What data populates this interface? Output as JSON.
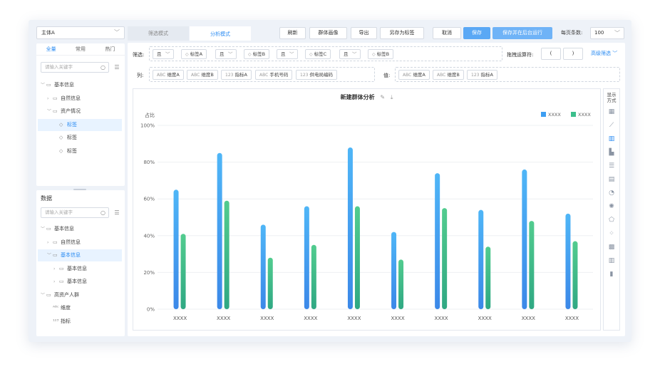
{
  "entity": {
    "value": "主体A"
  },
  "left_top": {
    "tabs": [
      "全量",
      "常用",
      "热门"
    ],
    "active_tab": 0,
    "search_placeholder": "请输入关键字",
    "tree": [
      {
        "label": "基本信息",
        "level": 0,
        "caret": "﹀",
        "icon": "folder-icon"
      },
      {
        "label": "自然信息",
        "level": 1,
        "caret": "›",
        "icon": "folder-icon"
      },
      {
        "label": "资产情况",
        "level": 1,
        "caret": "﹀",
        "icon": "folder-icon"
      },
      {
        "label": "标签",
        "level": 2,
        "caret": "",
        "icon": "tag-icon",
        "selected": true
      },
      {
        "label": "标签",
        "level": 2,
        "caret": "",
        "icon": "tag-icon"
      },
      {
        "label": "标签",
        "level": 2,
        "caret": "",
        "icon": "tag-icon"
      }
    ]
  },
  "left_bottom": {
    "title": "数据",
    "search_placeholder": "请输入关键字",
    "tree": [
      {
        "label": "基本信息",
        "level": 0,
        "caret": "﹀",
        "icon": "folder-icon"
      },
      {
        "label": "自然信息",
        "level": 1,
        "caret": "›",
        "icon": "folder-icon"
      },
      {
        "label": "基本信息",
        "level": 1,
        "caret": "﹀",
        "icon": "folder-icon",
        "selected": true
      },
      {
        "label": "基本信息",
        "level": 2,
        "caret": "›",
        "icon": "folder-icon"
      },
      {
        "label": "基本信息",
        "level": 2,
        "caret": "›",
        "icon": "folder-icon"
      },
      {
        "label": "高资产人群",
        "level": 0,
        "caret": "﹀",
        "icon": "folder-icon"
      },
      {
        "label": "维度",
        "level": 1,
        "caret": "",
        "icon": "abc-icon"
      },
      {
        "label": "指标",
        "level": 1,
        "caret": "",
        "icon": "number-icon"
      }
    ]
  },
  "mode_tabs": {
    "filter": "筛选模式",
    "analysis": "分析模式"
  },
  "toolbar": {
    "refresh": "刷新",
    "portrait": "群体画像",
    "export": "导出",
    "save_as_tag": "另存为标签",
    "cancel": "取消",
    "save": "保存",
    "save_run": "保存并在后台运行",
    "per_page_label": "每页条数:",
    "per_page_value": "100"
  },
  "filter_row": {
    "label": "筛选:",
    "items": [
      {
        "type": "select",
        "text": "且"
      },
      {
        "type": "tag",
        "text": "标签A"
      },
      {
        "type": "select",
        "text": "且"
      },
      {
        "type": "tag",
        "text": "标签B"
      },
      {
        "type": "select",
        "text": "且"
      },
      {
        "type": "tag",
        "text": "标签C"
      },
      {
        "type": "select",
        "text": "且"
      },
      {
        "type": "tag",
        "text": "标签B"
      }
    ],
    "drag_label": "拖拽运算符:",
    "paren_open": "(",
    "paren_close": ")",
    "advanced": "高级筛选 ﹀"
  },
  "column_row": {
    "label": "列:",
    "items": [
      {
        "icon": "ABC",
        "text": "维度A"
      },
      {
        "icon": "ABC",
        "text": "维度B"
      },
      {
        "icon": "123",
        "text": "指标A"
      },
      {
        "icon": "ABC",
        "text": "手机号码"
      },
      {
        "icon": "123",
        "text": "供电局编码"
      }
    ]
  },
  "value_row": {
    "label": "值:",
    "items": [
      {
        "icon": "ABC",
        "text": "维度A"
      },
      {
        "icon": "ABC",
        "text": "维度B"
      },
      {
        "icon": "123",
        "text": "指标A"
      }
    ]
  },
  "chart_title": "新建群体分析",
  "right_bar": {
    "title_line1": "显示",
    "title_line2": "方式",
    "icons": [
      "table-icon",
      "line-chart-icon",
      "bar-chart-icon",
      "area-bar-icon",
      "horizontal-bar-icon",
      "stacked-bar-icon",
      "pie-chart-icon",
      "radar-icon",
      "pentagon-icon",
      "scatter-icon",
      "heatmap-icon",
      "histogram-icon",
      "column-icon"
    ],
    "active_index": 2
  },
  "colors": {
    "series1": "#3d9ef2",
    "series2": "#3cbf8c",
    "accent": "#2a8bf2"
  },
  "chart_data": {
    "type": "bar",
    "title": "新建群体分析",
    "ylabel": "占比",
    "xlabel": "",
    "ylim": [
      0,
      100
    ],
    "yticks": [
      "0%",
      "20%",
      "40%",
      "60%",
      "80%",
      "100%"
    ],
    "categories": [
      "XXXX",
      "XXXX",
      "XXXX",
      "XXXX",
      "XXXX",
      "XXXX",
      "XXXX",
      "XXXX",
      "XXXX",
      "XXXX"
    ],
    "series": [
      {
        "name": "XXXX",
        "values": [
          65,
          85,
          46,
          56,
          88,
          42,
          74,
          54,
          76,
          52
        ]
      },
      {
        "name": "XXXX",
        "values": [
          41,
          59,
          28,
          35,
          56,
          27,
          55,
          34,
          48,
          37
        ]
      }
    ],
    "legend": "top-right",
    "grid": true
  }
}
